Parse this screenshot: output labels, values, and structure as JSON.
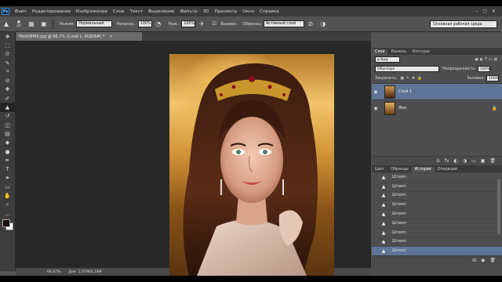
{
  "menu": {
    "logo": "Ps",
    "items": [
      "Файл",
      "Редактирование",
      "Изображение",
      "Слои",
      "Текст",
      "Выделение",
      "Фильтр",
      "3D",
      "Просмотр",
      "Окно",
      "Справка"
    ],
    "window_controls": [
      "–",
      "▢",
      "✕"
    ]
  },
  "options": {
    "brush_size": "24",
    "mode_label": "Режим:",
    "mode_value": "Нормальный",
    "opacity_label": "Непрозр.:",
    "opacity_value": "100%",
    "pressure_label": "Наж.:",
    "pressure_value": "100%",
    "align_label": "Выравн.",
    "sample_label": "Образец:",
    "sample_value": "Активный слой",
    "workspace": "Основная рабочая среда"
  },
  "document": {
    "tab_title": "f8e008f93.jpg @ 66,7% (Слой 1, RGB/8#) *",
    "tab_close": "×",
    "zoom": "66,67%",
    "info": "Док: 1,07M/4,14M"
  },
  "tools": [
    {
      "name": "move-tool",
      "glyph": "✥"
    },
    {
      "name": "marquee-tool",
      "glyph": "⬚"
    },
    {
      "name": "lasso-tool",
      "glyph": "ᘓ"
    },
    {
      "name": "quick-select-tool",
      "glyph": "✎"
    },
    {
      "name": "crop-tool",
      "glyph": "⌗"
    },
    {
      "name": "eyedropper-tool",
      "glyph": "⊘"
    },
    {
      "name": "healing-tool",
      "glyph": "✚"
    },
    {
      "name": "brush-tool",
      "glyph": "✐"
    },
    {
      "name": "clone-stamp-tool",
      "glyph": "▲"
    },
    {
      "name": "history-brush-tool",
      "glyph": "↺"
    },
    {
      "name": "eraser-tool",
      "glyph": "◫"
    },
    {
      "name": "gradient-tool",
      "glyph": "▤"
    },
    {
      "name": "blur-tool",
      "glyph": "◆"
    },
    {
      "name": "dodge-tool",
      "glyph": "●"
    },
    {
      "name": "pen-tool",
      "glyph": "✒"
    },
    {
      "name": "type-tool",
      "glyph": "T"
    },
    {
      "name": "path-select-tool",
      "glyph": "➤"
    },
    {
      "name": "shape-tool",
      "glyph": "▭"
    },
    {
      "name": "hand-tool",
      "glyph": "✋"
    },
    {
      "name": "zoom-tool",
      "glyph": "⌕"
    },
    {
      "name": "extra-tool",
      "glyph": "…"
    }
  ],
  "layers_panel": {
    "tabs": [
      "Слои",
      "Каналы",
      "Контуры"
    ],
    "kind_label": "ρ Вид",
    "blend_mode": "Обычные",
    "opacity_label": "Непрозрачность:",
    "opacity_value": "100%",
    "lock_label": "Закрепить:",
    "fill_label": "Заливка:",
    "fill_value": "100%",
    "layers": [
      {
        "name": "Слой 1",
        "selected": true
      },
      {
        "name": "Фон",
        "selected": false
      }
    ],
    "footer_icons": [
      "⊖",
      "fx",
      "◐",
      "◑",
      "▭",
      "▣",
      "🗑"
    ]
  },
  "history_panel": {
    "tabs": [
      "Цвет",
      "Образцы",
      "История",
      "Операции"
    ],
    "items": [
      "Штамп",
      "Штамп",
      "Штамп",
      "Штамп",
      "Штамп",
      "Штамп",
      "Штамп",
      "Штамп",
      "Штамп"
    ],
    "selected_index": 8,
    "footer_icons": [
      "⊟",
      "◉",
      "🗑"
    ]
  }
}
